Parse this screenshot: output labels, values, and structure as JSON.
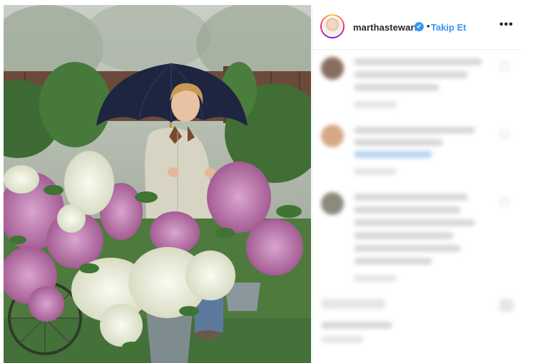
{
  "post": {
    "username": "marthastewart",
    "verified_mark": "✔",
    "separator": "•",
    "follow_label": "Takip Et",
    "more_label": "•••",
    "icons": {
      "avatar": "profile-avatar",
      "verified": "verified-badge-icon",
      "more": "more-options-icon"
    }
  },
  "colors": {
    "accent": "#3897f0",
    "text": "#262626",
    "divider": "#efefef"
  }
}
